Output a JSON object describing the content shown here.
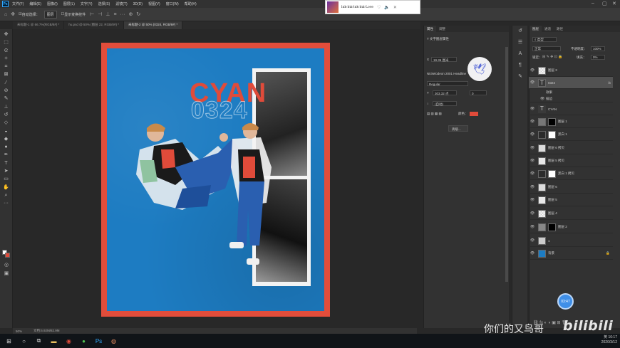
{
  "menubar": {
    "items": [
      "文件(F)",
      "编辑(E)",
      "图像(I)",
      "图层(L)",
      "文字(Y)",
      "选择(S)",
      "滤镜(T)",
      "3D(D)",
      "视图(V)",
      "窗口(W)",
      "帮助(H)"
    ]
  },
  "options_bar": {
    "auto_select_label": "自动选择：",
    "auto_select_value": "图层",
    "transform_label": "显示变换控件"
  },
  "doc_tabs": [
    {
      "label": "未标题-1 @ 66.7%(RGB/8#) *"
    },
    {
      "label": "hu.psd @ 50% (图层 22, RGB/8#) *"
    },
    {
      "label": "未标题-2 @ 50% (0324, RGB/8#) *"
    }
  ],
  "poster": {
    "title": "CYAN",
    "outline_number": "0324"
  },
  "properties": {
    "tabs": [
      "属性",
      "调整"
    ],
    "section_label": "文字图层属性",
    "xy_label": "X",
    "x_value": "19.36 厘米",
    "font_name": "Nickelodeon 2001 Headline",
    "font_style": "Regular",
    "font_size": "303.32 点",
    "tracking": "0",
    "leading": "(自动)",
    "color_label": "颜色：",
    "more_button": "高级..."
  },
  "layers": {
    "tabs": [
      "图层",
      "通道",
      "路径"
    ],
    "filter_label": "类型",
    "blend_mode": "正常",
    "opacity_label": "不透明度：",
    "opacity_value": "100%",
    "lock_label": "锁定：",
    "fill_label": "填充：",
    "fill_value": "0%",
    "rows": [
      {
        "name": "图层 3",
        "kind": "checker"
      },
      {
        "name": "0324",
        "kind": "text",
        "fx": "fx"
      },
      {
        "name": "效果",
        "kind": "sub"
      },
      {
        "name": "描边",
        "kind": "sub2"
      },
      {
        "name": "CYAN",
        "kind": "text"
      },
      {
        "name": "图层 1",
        "kind": "photo-mask"
      },
      {
        "name": "黑白 1",
        "kind": "adjust"
      },
      {
        "name": "图层 6 拷贝",
        "kind": "photo"
      },
      {
        "name": "图层 5 拷贝",
        "kind": "photo"
      },
      {
        "name": "黑白 1 拷贝",
        "kind": "adjust"
      },
      {
        "name": "图层 6",
        "kind": "photo"
      },
      {
        "name": "图层 5",
        "kind": "photo"
      },
      {
        "name": "图层 4",
        "kind": "checker"
      },
      {
        "name": "图层 2",
        "kind": "photo-mask"
      },
      {
        "name": "1",
        "kind": "photo"
      },
      {
        "name": "背景",
        "kind": "blue"
      }
    ]
  },
  "status": {
    "zoom": "50%",
    "doc_info": "文档:6.92M/82.9M"
  },
  "music_widget": {
    "title": "lnk-lnk-lnk-lnk-Love"
  },
  "timer": "03:47",
  "watermark": {
    "name": "你们的又鸟哥",
    "logo": "bilibili"
  },
  "taskbar": {
    "time": "16:17",
    "date": "2020/3/12",
    "lang": "英"
  },
  "colors": {
    "poster_blue": "#1d7cc2",
    "accent_red": "#e04b3a",
    "ui_dark": "#323232"
  }
}
